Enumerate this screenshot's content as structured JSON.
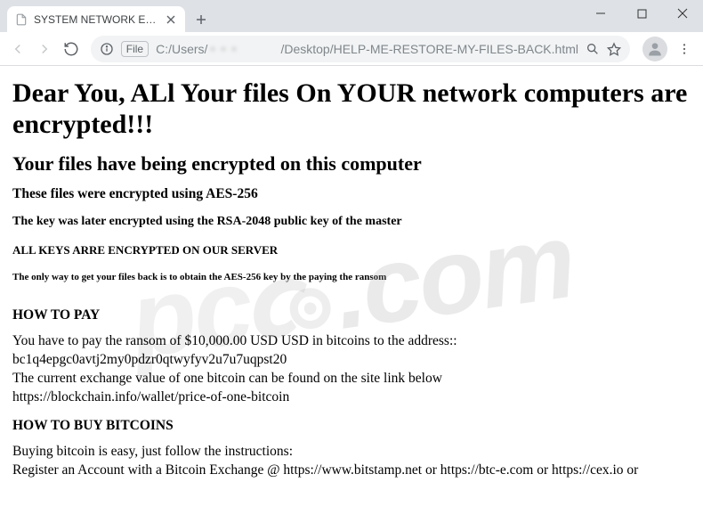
{
  "window": {
    "tab_title": "SYSTEM NETWORK ENCRYPTED"
  },
  "toolbar": {
    "file_badge": "File",
    "url_prefix": "C:/Users/",
    "url_suffix": "/Desktop/HELP-ME-RESTORE-MY-FILES-BACK.html"
  },
  "page": {
    "h1": "Dear You, ALl Your files On YOUR network computers are encrypted!!!",
    "h2": "Your files have being encrypted on this computer",
    "h3": "These files were encrypted using AES-256",
    "h4": "The key was later encrypted using the RSA-2048 public key of the master",
    "h5": "ALL KEYS ARRE ENCRYPTED ON OUR SERVER",
    "h6": "The only way to get your files back is to obtain the AES-256 key by the paying the ransom",
    "howtopay_title": "HOW TO PAY",
    "pay_line1": "You have to pay the ransom of $10,000.00 USD USD in bitcoins to the address::",
    "pay_line2": "bc1q4epgc0avtj2my0pdzr0qtwyfyv2u7u7uqpst20",
    "pay_line3": "The current exchange value of one bitcoin can be found on the site link below",
    "pay_line4": "https://blockchain.info/wallet/price-of-one-bitcoin",
    "howtobuy_title": "HOW TO BUY BITCOINS",
    "buy_line1": "Buying bitcoin is easy, just follow the instructions:",
    "buy_line2": "Register an Account with a Bitcoin Exchange @ https://www.bitstamp.net or https://btc-e.com or https://cex.io or"
  },
  "watermark": {
    "left": "pc",
    "right": ".com"
  }
}
